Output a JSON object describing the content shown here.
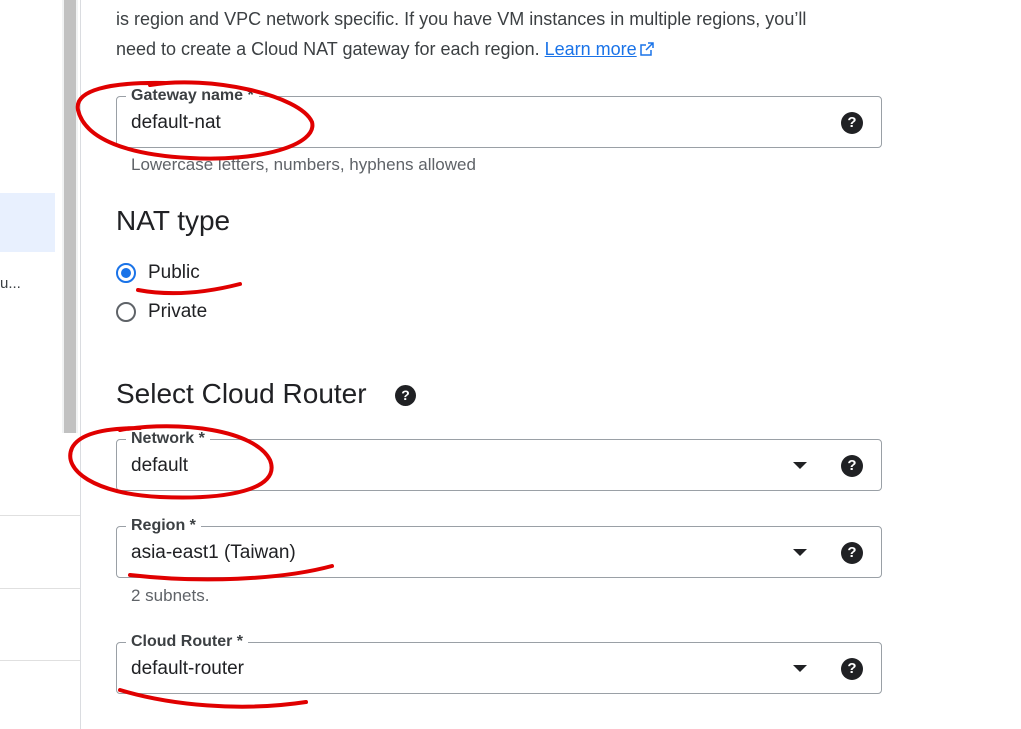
{
  "intro": {
    "line1": "is region and VPC network specific. If you have VM instances in multiple regions, you’ll",
    "line2": "need to create a Cloud NAT gateway for each region.",
    "learn_more": "Learn more"
  },
  "left_nav": {
    "truncated_item": "u..."
  },
  "gateway": {
    "label": "Gateway name *",
    "value": "default-nat",
    "hint": "Lowercase letters, numbers, hyphens allowed"
  },
  "nat_type": {
    "title": "NAT type",
    "options": [
      {
        "label": "Public",
        "selected": true
      },
      {
        "label": "Private",
        "selected": false
      }
    ]
  },
  "router_section": {
    "title": "Select Cloud Router",
    "network": {
      "label": "Network *",
      "value": "default"
    },
    "region": {
      "label": "Region *",
      "value": "asia-east1 (Taiwan)",
      "hint": "2 subnets."
    },
    "cloud_router": {
      "label": "Cloud Router *",
      "value": "default-router"
    }
  },
  "icons": {
    "help": "help-circle-icon",
    "dropdown": "arrow-drop-down-icon",
    "external_link": "open-in-new-icon"
  },
  "colors": {
    "accent": "#1a73e8",
    "annotation": "#e00000"
  }
}
